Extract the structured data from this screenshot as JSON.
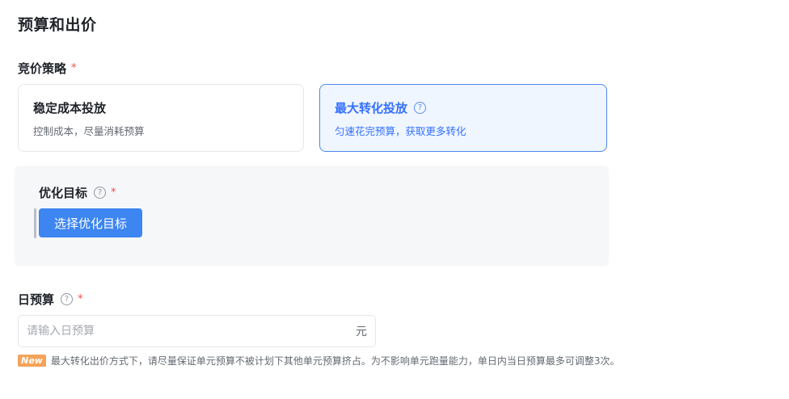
{
  "section": {
    "title": "预算和出价"
  },
  "bid_strategy": {
    "label": "竞价策略",
    "required_mark": "*",
    "options": [
      {
        "title": "稳定成本投放",
        "desc": "控制成本，尽量消耗预算"
      },
      {
        "title": "最大转化投放",
        "desc": "匀速花完预算，获取更多转化",
        "help_icon": "question-circle-icon"
      }
    ],
    "selected": "最大转化投放"
  },
  "optimize_target": {
    "label": "优化目标",
    "required_mark": "*",
    "help_icon": "question-circle-icon",
    "button_label": "选择优化目标"
  },
  "daily_budget": {
    "label": "日预算",
    "required_mark": "*",
    "help_icon": "question-circle-icon",
    "placeholder": "请输入日预算",
    "value": "",
    "unit": "元"
  },
  "notice": {
    "badge": "New",
    "text": "最大转化出价方式下，请尽量保证单元预算不被计划下其他单元预算挤占。为不影响单元跑量能力，单日内当日预算最多可调整3次。"
  },
  "colors": {
    "accent": "#3370ff",
    "button": "#3d85f0",
    "required": "#f54a45",
    "badge": "#f5a35b"
  }
}
